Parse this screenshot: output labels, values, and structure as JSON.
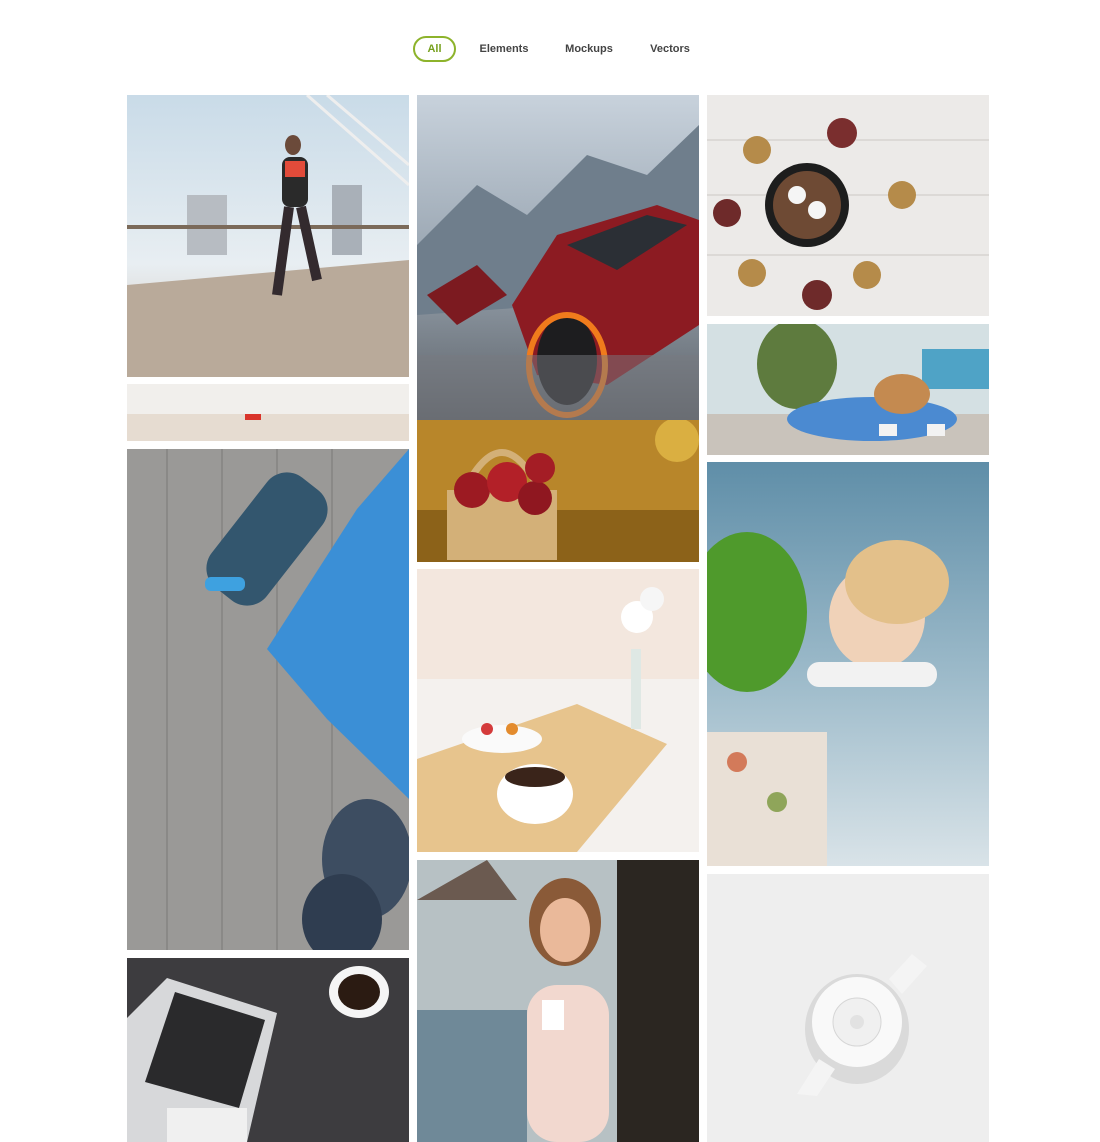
{
  "filters": {
    "all": "All",
    "elements": "Elements",
    "mockups": "Mockups",
    "vectors": "Vectors"
  },
  "accent_color": "#8db32b",
  "gallery": {
    "items": [
      {
        "subject": "runner-on-bridge"
      },
      {
        "subject": "beach-horizon"
      },
      {
        "subject": "water-bottle-yoga-mat"
      },
      {
        "subject": "laptop-coffee-desk"
      },
      {
        "subject": "red-sports-car"
      },
      {
        "subject": "apple-basket"
      },
      {
        "subject": "breakfast-tray"
      },
      {
        "subject": "woman-on-phone"
      },
      {
        "subject": "hot-chocolate-pinecones"
      },
      {
        "subject": "child-on-beanbag"
      },
      {
        "subject": "child-lifted"
      },
      {
        "subject": "white-teapot"
      }
    ]
  }
}
